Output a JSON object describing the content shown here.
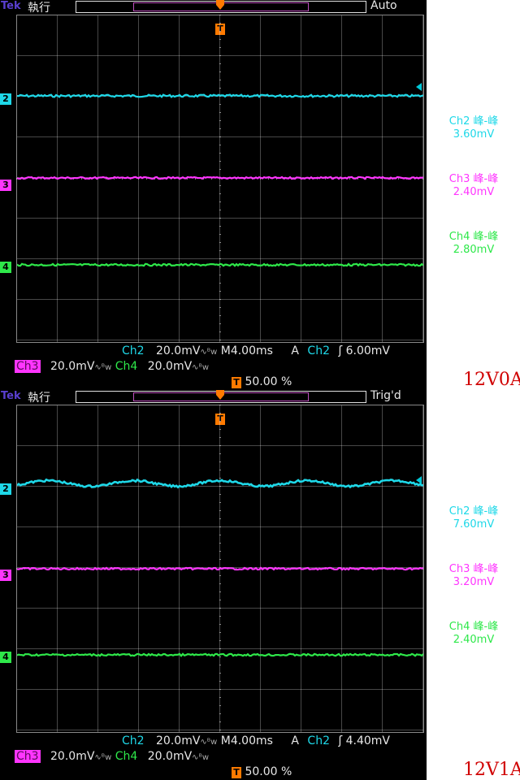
{
  "screens": [
    {
      "brand": "Tek",
      "run_status": "執行",
      "mode": "Auto",
      "caption": "12V0A",
      "colors": {
        "ch2": "#1ed8e8",
        "ch3": "#ff35ff",
        "ch4": "#2ee84a",
        "trigger": "#ff7a00"
      },
      "measurements": [
        {
          "label": "Ch2 峰-峰",
          "value": "3.60mV"
        },
        {
          "label": "Ch3 峰-峰",
          "value": "2.40mV"
        },
        {
          "label": "Ch4 峰-峰",
          "value": "2.80mV"
        }
      ],
      "status": {
        "ch2": "Ch2",
        "ch2_scale": "20.0mV",
        "timebase": "M4.00ms",
        "trig_type": "A",
        "trig_src": "Ch2",
        "trig_level": "6.00mV",
        "ch3": "Ch3",
        "ch3_scale": "20.0mV",
        "ch4": "Ch4",
        "ch4_scale": "20.0mV",
        "trig_pos": "50.00 %"
      },
      "markers": {
        "ch2": "2",
        "ch3": "3",
        "ch4": "4",
        "trigger": "T"
      }
    },
    {
      "brand": "Tek",
      "run_status": "執行",
      "mode": "Trig'd",
      "caption": "12V1A",
      "colors": {
        "ch2": "#1ed8e8",
        "ch3": "#ff35ff",
        "ch4": "#2ee84a",
        "trigger": "#ff7a00"
      },
      "measurements": [
        {
          "label": "Ch2 峰-峰",
          "value": "7.60mV"
        },
        {
          "label": "Ch3 峰-峰",
          "value": "3.20mV"
        },
        {
          "label": "Ch4 峰-峰",
          "value": "2.40mV"
        }
      ],
      "status": {
        "ch2": "Ch2",
        "ch2_scale": "20.0mV",
        "timebase": "M4.00ms",
        "trig_type": "A",
        "trig_src": "Ch2",
        "trig_level": "4.40mV",
        "ch3": "Ch3",
        "ch3_scale": "20.0mV",
        "ch4": "Ch4",
        "ch4_scale": "20.0mV",
        "trig_pos": "50.00 %"
      },
      "markers": {
        "ch2": "2",
        "ch3": "3",
        "ch4": "4",
        "trigger": "T"
      }
    }
  ]
}
